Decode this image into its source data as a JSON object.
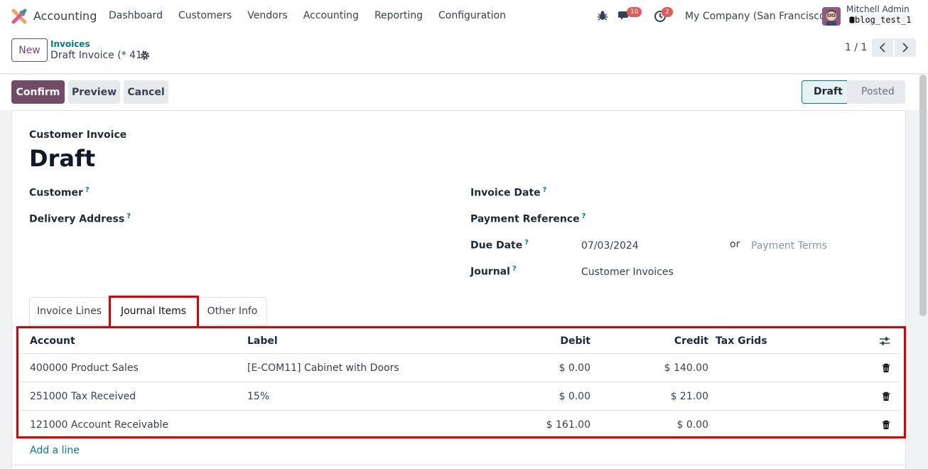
{
  "app": {
    "name": "Accounting",
    "logo_icon": "odoo-accounting-logo-icon"
  },
  "menu": [
    "Dashboard",
    "Customers",
    "Vendors",
    "Accounting",
    "Reporting",
    "Configuration"
  ],
  "systray": {
    "messages_count": "10",
    "activities_count": "2",
    "company": "My Company (San Francisco)",
    "user_name": "Mitchell Admin",
    "database": "blog_test_1"
  },
  "control": {
    "new_label": "New",
    "breadcrumb_parent": "Invoices",
    "breadcrumb_current": "Draft Invoice (* 41)",
    "pager": "1 / 1"
  },
  "actions": {
    "confirm": "Confirm",
    "preview": "Preview",
    "cancel": "Cancel"
  },
  "statusbar": {
    "draft": "Draft",
    "posted": "Posted"
  },
  "form": {
    "doc_type": "Customer Invoice",
    "doc_name": "Draft",
    "customer_label": "Customer",
    "delivery_label": "Delivery Address",
    "invoice_date_label": "Invoice Date",
    "payment_ref_label": "Payment Reference",
    "due_date_label": "Due Date",
    "due_date_value": "07/03/2024",
    "or_label": "or",
    "payment_terms_placeholder": "Payment Terms",
    "journal_label": "Journal",
    "journal_value": "Customer Invoices",
    "help_mark": "?"
  },
  "tabs": [
    "Invoice Lines",
    "Journal Items",
    "Other Info"
  ],
  "journal_items": {
    "columns": {
      "account": "Account",
      "label": "Label",
      "debit": "Debit",
      "credit": "Credit",
      "tax_grids": "Tax Grids"
    },
    "rows": [
      {
        "account": "400000 Product Sales",
        "label": "[E-COM11] Cabinet with Doors",
        "debit": "$ 0.00",
        "credit": "$ 140.00",
        "tax_grids": ""
      },
      {
        "account": "251000 Tax Received",
        "label": "15%",
        "debit": "$ 0.00",
        "credit": "$ 21.00",
        "tax_grids": ""
      },
      {
        "account": "121000 Account Receivable",
        "label": "",
        "debit": "$ 161.00",
        "credit": "$ 0.00",
        "tax_grids": ""
      }
    ],
    "add_line": "Add a line"
  },
  "colors": {
    "brand": "#714b67",
    "link": "#017e84",
    "highlight": "#e00000",
    "badge": "#e05a5a"
  }
}
